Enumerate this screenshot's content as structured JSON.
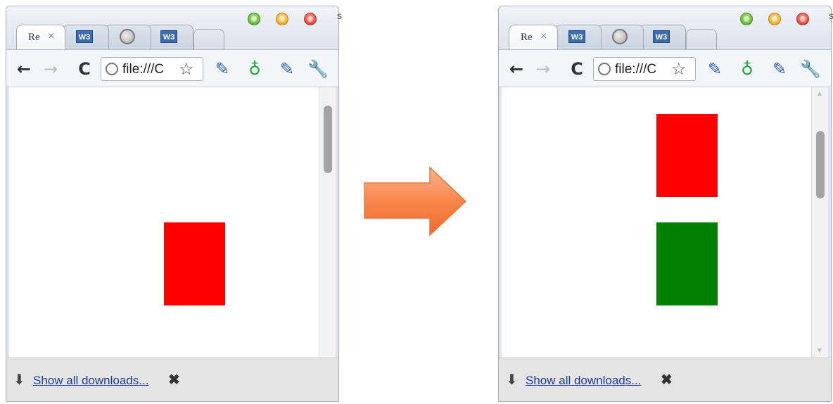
{
  "colors": {
    "red_rect": "#ff0000",
    "green_rect": "#008000",
    "arrow": "#f87a3a",
    "link": "#1d3c96"
  },
  "left_window": {
    "tabs": [
      {
        "label": "Re",
        "close": "×",
        "icon": "page"
      },
      {
        "label": "W3",
        "icon": "w3-icon"
      },
      {
        "label": "",
        "icon": "globe-icon"
      },
      {
        "label": "W3",
        "icon": "w3-icon"
      },
      {
        "label": "",
        "icon": "new-tab"
      }
    ],
    "toolbar": {
      "back": "←",
      "forward": "→",
      "reload": "C",
      "address": "file:///C",
      "star": "☆",
      "dropper1": "✎",
      "timer": "♁",
      "dropper2": "✎",
      "wrench": "🔧"
    },
    "page": {
      "rectangles": [
        "red"
      ]
    },
    "download_bar": {
      "arrow": "⬇",
      "link": "Show all downloads...",
      "close": "✖"
    },
    "edge_char": "s"
  },
  "right_window": {
    "tabs": [
      {
        "label": "Re",
        "close": "×",
        "icon": "page"
      },
      {
        "label": "W3",
        "icon": "w3-icon"
      },
      {
        "label": "",
        "icon": "globe-icon"
      },
      {
        "label": "W3",
        "icon": "w3-icon"
      },
      {
        "label": "",
        "icon": "new-tab"
      }
    ],
    "toolbar": {
      "back": "←",
      "forward": "→",
      "reload": "C",
      "address": "file:///C",
      "star": "☆",
      "dropper1": "✎",
      "timer": "♁",
      "dropper2": "✎",
      "wrench": "🔧"
    },
    "page": {
      "rectangles": [
        "red",
        "green"
      ]
    },
    "scroll": {
      "up": "▲",
      "down": "▼"
    },
    "download_bar": {
      "arrow": "⬇",
      "link": "Show all downloads...",
      "close": "✖"
    },
    "edge_char": "s"
  }
}
